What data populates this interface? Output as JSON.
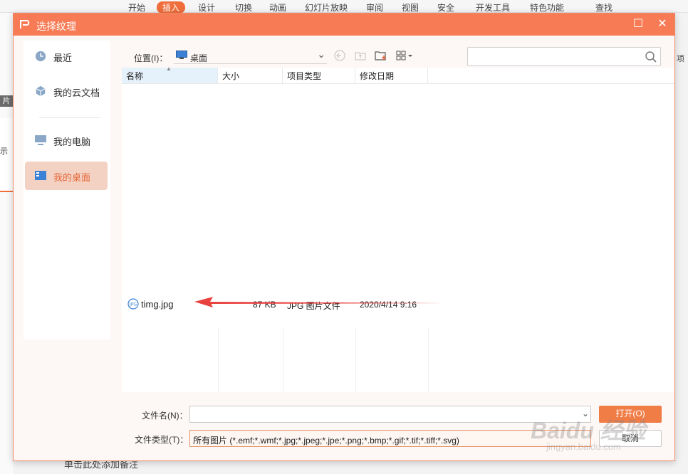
{
  "background_app": {
    "ribbon_tabs": [
      "开始",
      "插入",
      "设计",
      "切换",
      "动画",
      "幻灯片放映",
      "审阅",
      "视图",
      "安全",
      "开发工具",
      "特色功能",
      "查找"
    ],
    "active_tab": "插入",
    "side_thumb_label": "片",
    "slide_text": "示",
    "bottom_text": "单击此处添加备注",
    "right_text": "项"
  },
  "dialog": {
    "title": "选择纹理",
    "maximize_glyph": "☐",
    "close_glyph": "✕"
  },
  "nav": {
    "items": [
      {
        "label": "最近",
        "icon": "clock-icon"
      },
      {
        "label": "我的云文档",
        "icon": "cloud-cube-icon"
      },
      {
        "label": "我的电脑",
        "icon": "computer-icon"
      },
      {
        "label": "我的桌面",
        "icon": "desktop-icon",
        "selected": true
      }
    ]
  },
  "toolbar": {
    "location_label": "位置(I)：",
    "location_value": "桌面",
    "search_placeholder": ""
  },
  "file_list": {
    "columns": [
      "名称",
      "大小",
      "项目类型",
      "修改日期"
    ],
    "sorted_column": "名称",
    "rows": [
      {
        "name": "timg.jpg",
        "size": "87 KB",
        "type": "JPG 图片文件",
        "modified": "2020/4/14 9:16"
      }
    ]
  },
  "form": {
    "filename_label": "文件名(N)：",
    "filename_value": "",
    "filetype_label": "文件类型(T)：",
    "filetype_value": "所有图片 (*.emf;*.wmf;*.jpg;*.jpeg;*.jpe;*.png;*.bmp;*.gif;*.tif;*.tiff;*.svg)",
    "open_button": "打开(O)",
    "cancel_button": "取消"
  },
  "watermark": {
    "brand": "Baidu 经验",
    "url": "jingyan.baidu.com"
  },
  "colors": {
    "accent": "#f77b55",
    "selected_nav_bg": "#f3d2c3",
    "arrow": "#e8413e"
  }
}
